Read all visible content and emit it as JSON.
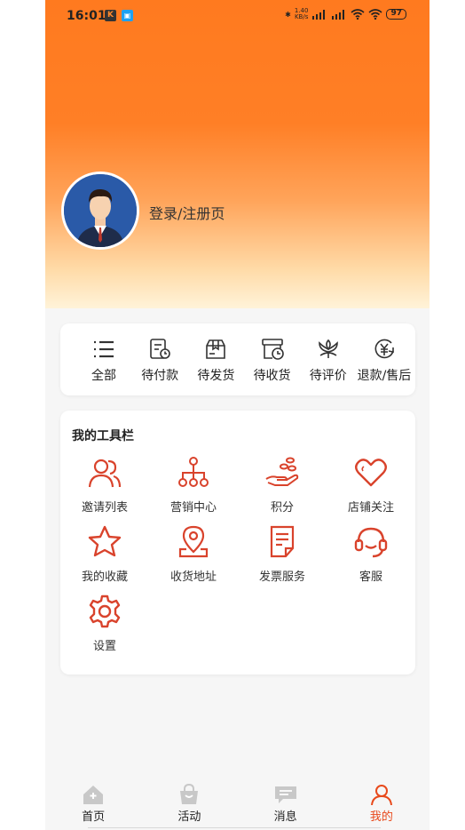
{
  "status_bar": {
    "time": "16:01",
    "speed_value": "1.40",
    "speed_unit": "KB/s",
    "network1": "5G HD",
    "network2": "5G HD",
    "battery": "97"
  },
  "profile": {
    "login_text": "登录/注册页"
  },
  "orders": [
    {
      "label": "全部",
      "icon": "list-icon"
    },
    {
      "label": "待付款",
      "icon": "payment-pending-icon"
    },
    {
      "label": "待发货",
      "icon": "package-icon"
    },
    {
      "label": "待收货",
      "icon": "box-clock-icon"
    },
    {
      "label": "待评价",
      "icon": "flower-review-icon"
    },
    {
      "label": "退款/售后",
      "icon": "yen-refund-icon"
    }
  ],
  "toolbar": {
    "title": "我的工具栏",
    "items": [
      {
        "label": "邀请列表",
        "icon": "users-icon"
      },
      {
        "label": "营销中心",
        "icon": "hierarchy-icon"
      },
      {
        "label": "积分",
        "icon": "points-hand-icon"
      },
      {
        "label": "店铺关注",
        "icon": "heart-icon"
      },
      {
        "label": "我的收藏",
        "icon": "star-icon"
      },
      {
        "label": "收货地址",
        "icon": "location-pin-icon"
      },
      {
        "label": "发票服务",
        "icon": "invoice-icon"
      },
      {
        "label": "客服",
        "icon": "headset-icon"
      },
      {
        "label": "设置",
        "icon": "gear-icon"
      }
    ]
  },
  "tabs": [
    {
      "label": "首页",
      "icon": "home-icon",
      "active": false
    },
    {
      "label": "活动",
      "icon": "shopping-bag-icon",
      "active": false
    },
    {
      "label": "消息",
      "icon": "message-icon",
      "active": false
    },
    {
      "label": "我的",
      "icon": "user-icon",
      "active": true
    }
  ],
  "colors": {
    "accent": "#e84a1c",
    "header_top": "#ff7a1f",
    "header_bottom": "#fff3d9"
  }
}
